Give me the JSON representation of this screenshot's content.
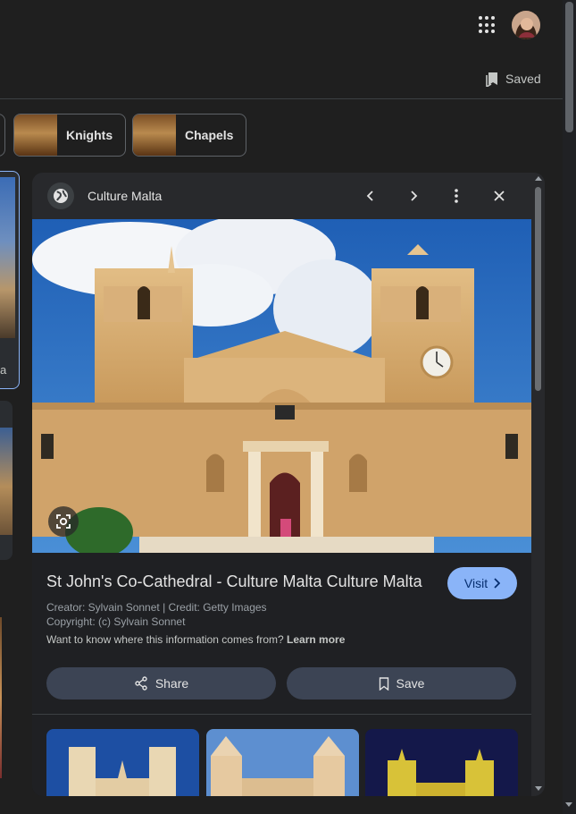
{
  "header": {
    "apps_icon": "apps-grid-icon",
    "avatar_icon": "user-avatar",
    "saved_label": "Saved"
  },
  "chips": [
    {
      "label": "Knights"
    },
    {
      "label": "Chapels"
    }
  ],
  "edge_results": {
    "partial_text": "a"
  },
  "panel": {
    "source": "Culture Malta",
    "title": "St John's Co-Cathedral - Culture Malta Culture Malta",
    "visit_label": "Visit",
    "creator": "Creator: Sylvain Sonnet | Credit: Getty Images",
    "copyright": "Copyright: (c) Sylvain Sonnet",
    "info_question": "Want to know where this information comes from?",
    "learn_more": "Learn more",
    "share_label": "Share",
    "save_label": "Save"
  },
  "colors": {
    "background": "#1f1f1f",
    "panel": "#1f2023",
    "accent": "#8ab4f8",
    "action_button": "#3c4454"
  }
}
